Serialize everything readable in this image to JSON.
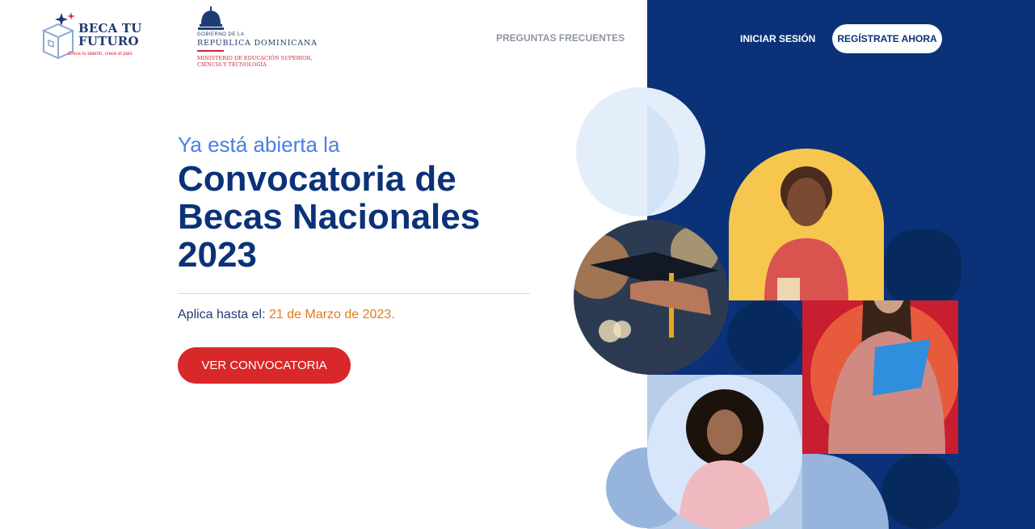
{
  "brand": {
    "name_line1": "BECA TU",
    "name_line2": "FUTURO",
    "tagline": "Crece tu talento, crece el país"
  },
  "gov": {
    "line_small": "GOBIERNO DE LA",
    "line_big": "REPÚBLICA DOMINICANA",
    "ministry_line1": "MINISTERIO DE EDUCACIÓN SUPERIOR,",
    "ministry_line2": "CIENCIA Y TECNOLOGÍA"
  },
  "nav": {
    "faq": "PREGUNTAS FRECUENTES",
    "login": "INICIAR SESIÓN",
    "register": "REGÍSTRATE AHORA"
  },
  "hero": {
    "pretitle": "Ya está abierta la",
    "title": "Convocatoria de Becas Nacionales 2023",
    "deadline_label": "Aplica hasta el:",
    "deadline_date": "21 de Marzo de 2023.",
    "cta": "VER CONVOCATORIA"
  },
  "colors": {
    "navy": "#0b3278",
    "accent_blue": "#4a7fe0",
    "cta_red": "#d8282a",
    "date_orange": "#e07a1f"
  }
}
